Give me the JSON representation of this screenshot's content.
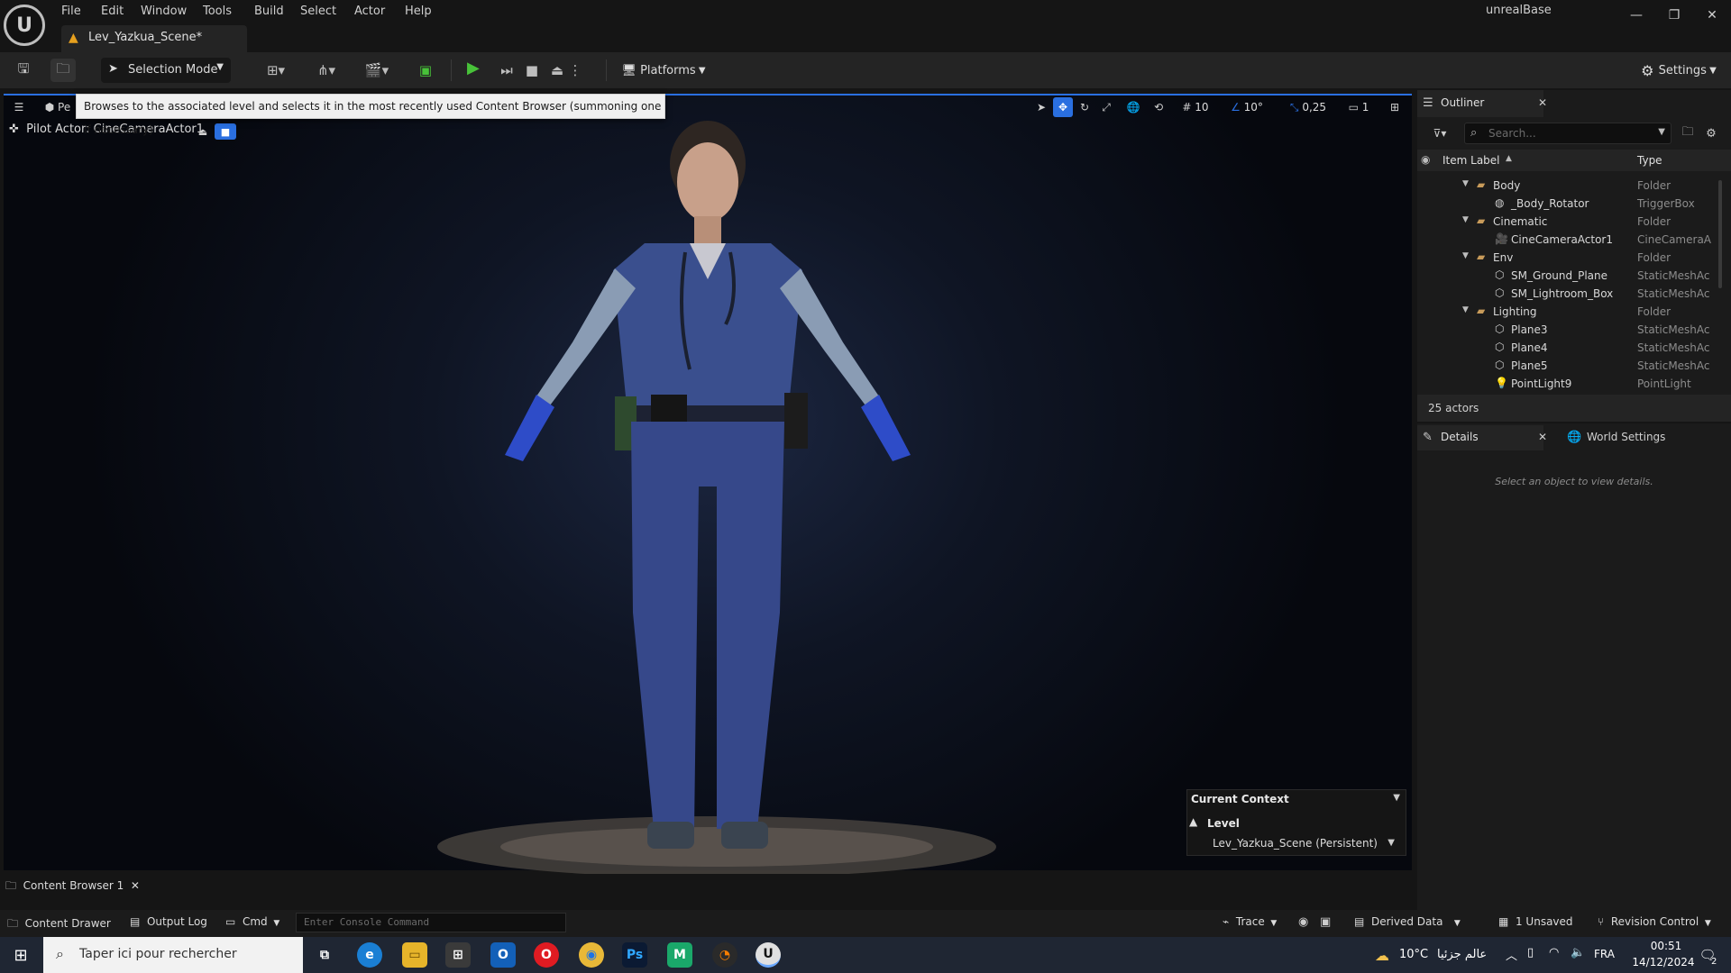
{
  "app_name": "unrealBase",
  "menu": [
    "File",
    "Edit",
    "Window",
    "Tools",
    "Build",
    "Select",
    "Actor",
    "Help"
  ],
  "document_tab": "Lev_Yazkua_Scene*",
  "toolbar": {
    "selection_mode": "Selection Mode",
    "platforms": "Platforms",
    "settings": "Settings"
  },
  "viewport": {
    "perspective_short": "Pe",
    "tooltip": "Browses to the associated level and selects it in the most recently used Content Browser (summoning one if necessary)",
    "pilot_actor": "Pilot Actor: CineCameraActor1",
    "grid_snap": "10",
    "rotation_snap": "10°",
    "scale_snap": "0,25",
    "camera_speed": "1"
  },
  "context": {
    "header": "Current Context",
    "level_label": "Level",
    "level_value": "Lev_Yazkua_Scene (Persistent)"
  },
  "outliner": {
    "tab": "Outliner",
    "search_placeholder": "Search...",
    "col_label": "Item Label",
    "col_type": "Type",
    "rows": [
      {
        "label": "Body",
        "type": "Folder",
        "depth": 0,
        "folder": true
      },
      {
        "label": "_Body_Rotator",
        "type": "TriggerBox",
        "depth": 1,
        "icon": "trigger-icon"
      },
      {
        "label": "Cinematic",
        "type": "Folder",
        "depth": 0,
        "folder": true
      },
      {
        "label": "CineCameraActor1",
        "type": "CineCameraA",
        "depth": 1,
        "icon": "camera-icon"
      },
      {
        "label": "Env",
        "type": "Folder",
        "depth": 0,
        "folder": true
      },
      {
        "label": "SM_Ground_Plane",
        "type": "StaticMeshAc",
        "depth": 1,
        "icon": "mesh-icon"
      },
      {
        "label": "SM_Lightroom_Box",
        "type": "StaticMeshAc",
        "depth": 1,
        "icon": "mesh-icon"
      },
      {
        "label": "Lighting",
        "type": "Folder",
        "depth": 0,
        "folder": true
      },
      {
        "label": "Plane3",
        "type": "StaticMeshAc",
        "depth": 1,
        "icon": "mesh-icon"
      },
      {
        "label": "Plane4",
        "type": "StaticMeshAc",
        "depth": 1,
        "icon": "mesh-icon"
      },
      {
        "label": "Plane5",
        "type": "StaticMeshAc",
        "depth": 1,
        "icon": "mesh-icon"
      },
      {
        "label": "PointLight9",
        "type": "PointLight",
        "depth": 1,
        "icon": "light-icon"
      }
    ],
    "actor_count": "25 actors"
  },
  "details": {
    "tab": "Details",
    "world_settings_tab": "World Settings",
    "empty_text": "Select an object to view details."
  },
  "bottom": {
    "content_browser_tab": "Content Browser 1",
    "content_drawer": "Content Drawer",
    "output_log": "Output Log",
    "cmd": "Cmd",
    "console_placeholder": "Enter Console Command",
    "trace": "Trace",
    "derived_data": "Derived Data",
    "unsaved": "1 Unsaved",
    "revision_control": "Revision Control"
  },
  "taskbar": {
    "search_placeholder": "Taper ici pour rechercher",
    "weather": "10°C",
    "weather_text": "عالم جزئيا",
    "lang": "FRA",
    "time": "00:51",
    "date": "14/12/2024",
    "notif_count": "2"
  },
  "colors": {
    "accent": "#2a6fe0",
    "play_green": "#48c239",
    "warning": "#e6a01e",
    "folder": "#c89b5a"
  }
}
